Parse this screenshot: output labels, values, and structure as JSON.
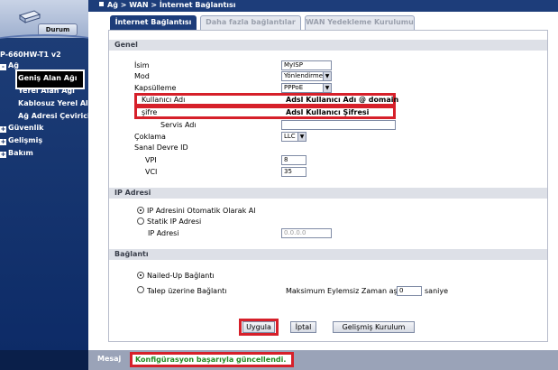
{
  "sidebar": {
    "status_button": "Durum",
    "model": "P-660HW-T1 v2",
    "nav": {
      "ag": "Ağ",
      "guvenlik": "Güvenlik",
      "gelismis": "Gelişmiş",
      "bakim": "Bakım"
    },
    "sub_items": [
      "Geniş Alan Ağı",
      "Yerel Alan Ağı",
      "Kablosuz Yerel Ala",
      "Ağ Adresi Çevirici"
    ],
    "expand_symbol": "-",
    "collapse_symbol": "+"
  },
  "header": {
    "breadcrumb": "Ağ > WAN > İnternet Bağlantısı"
  },
  "tabs": [
    "İnternet Bağlantısı",
    "Daha fazla bağlantılar",
    "WAN Yedekleme Kurulumu"
  ],
  "general": {
    "title": "Genel",
    "isim_label": "İsim",
    "isim_value": "MyISP",
    "mod_label": "Mod",
    "mod_value": "Yönlendirme",
    "kapsulleme_label": "Kapsülleme",
    "kapsulleme_value": "PPPoE",
    "kullanici_label": "Kullanıcı Adı",
    "kullanici_value": "Adsl Kullanıcı Adı @ domain",
    "sifre_label": "şifre",
    "sifre_value": "Adsl Kullanıcı Şifresi",
    "servis_label": "Servis Adı",
    "servis_value": "",
    "coklama_label": "Çoklama",
    "coklama_value": "LLC",
    "sanal_label": "Sanal Devre ID",
    "vpi_label": "VPI",
    "vpi_value": "8",
    "vci_label": "VCI",
    "vci_value": "35"
  },
  "ip": {
    "title": "IP Adresi",
    "auto_label": "IP Adresini Otomatik Olarak Al",
    "static_label": "Statik IP Adresi",
    "ip_label": "IP Adresi",
    "ip_value": "0.0.0.0",
    "selected": "auto"
  },
  "baglanti": {
    "title": "Bağlantı",
    "nailed_label": "Nailed-Up Bağlantı",
    "talep_label": "Talep üzerine Bağlantı",
    "idle_label": "Maksimum Eylemsiz Zaman aşımı",
    "idle_value": "0",
    "idle_unit": "saniye",
    "selected": "nailed"
  },
  "buttons": {
    "apply": "Uygula",
    "cancel": "İptal",
    "advanced": "Gelişmiş Kurulum"
  },
  "message": {
    "label": "Mesaj",
    "text": "Konfigürasyon başarıyla güncellendi."
  },
  "colors": {
    "nav_dark": "#1d3d7a",
    "highlight": "#d6202a",
    "success": "#1f8a1f"
  }
}
